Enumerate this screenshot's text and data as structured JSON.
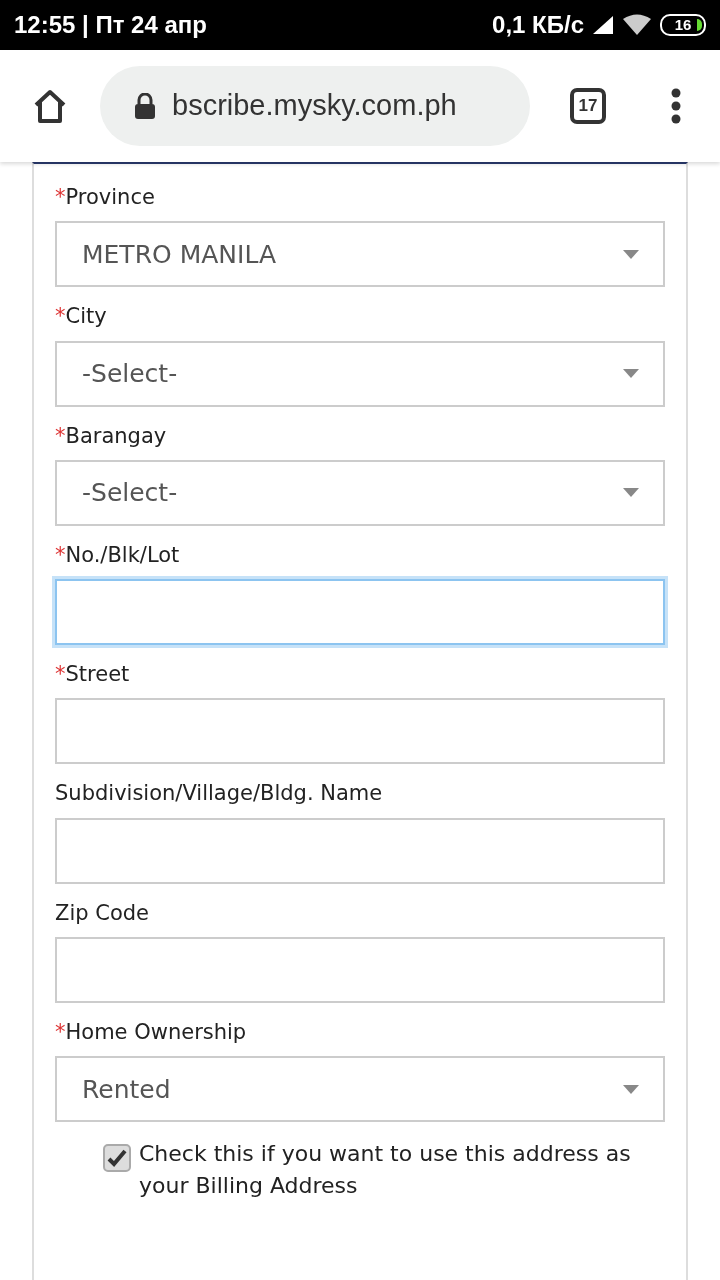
{
  "status_bar": {
    "time": "12:55 | Пт 24 апр",
    "speed": "0,1 КБ/с",
    "battery": "16"
  },
  "browser": {
    "url": "bscribe.mysky.com.ph",
    "tab_count": "17"
  },
  "form": {
    "required_marker": "*",
    "fields": [
      {
        "kind": "select",
        "label": "Province",
        "required": true,
        "value": "METRO MANILA",
        "focused": false
      },
      {
        "kind": "select",
        "label": "City",
        "required": true,
        "value": "-Select-",
        "focused": false
      },
      {
        "kind": "select",
        "label": "Barangay",
        "required": true,
        "value": "-Select-",
        "focused": false
      },
      {
        "kind": "input",
        "label": "No./Blk/Lot",
        "required": true,
        "focused": true
      },
      {
        "kind": "input",
        "label": "Street",
        "required": true,
        "focused": false
      },
      {
        "kind": "input",
        "label": "Subdivision/Village/Bldg. Name",
        "required": false,
        "focused": false
      },
      {
        "kind": "input",
        "label": "Zip Code",
        "required": false,
        "focused": false
      },
      {
        "kind": "select",
        "label": "Home Ownership",
        "required": true,
        "value": "Rented",
        "focused": false
      }
    ],
    "billing_checkbox": {
      "label": "Check this if you want to use this address as your Billing Address",
      "checked": true
    }
  }
}
